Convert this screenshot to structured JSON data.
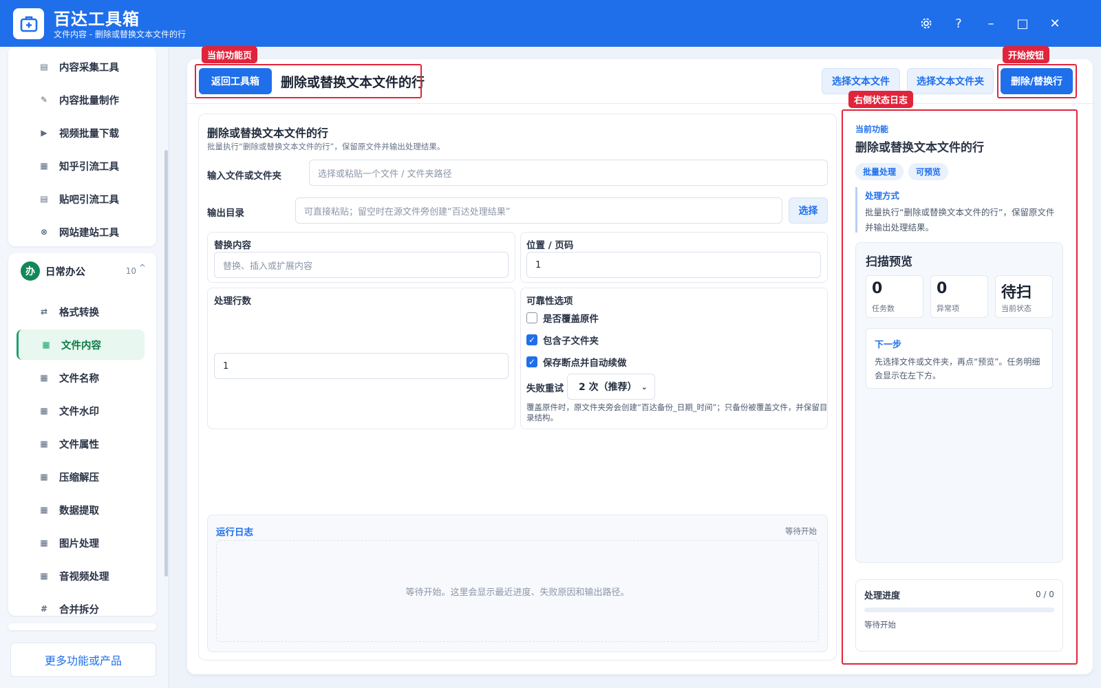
{
  "titlebar": {
    "title": "百达工具箱",
    "subtitle": "文件内容 - 删除或替换文本文件的行",
    "settings_icon": "gear-icon",
    "help_label": "?",
    "minimize_label": "–",
    "maximize_label": "□",
    "close_label": "✕"
  },
  "sidebar": {
    "top_items": [
      {
        "label": "内容采集工具",
        "icon": "▤"
      },
      {
        "label": "内容批量制作",
        "icon": "✎"
      },
      {
        "label": "视频批量下载",
        "icon": "▶"
      },
      {
        "label": "知乎引流工具",
        "icon": "▦"
      },
      {
        "label": "贴吧引流工具",
        "icon": "▤"
      },
      {
        "label": "网站建站工具",
        "icon": "⊗"
      }
    ],
    "group": {
      "badge": "办",
      "name": "日常办公",
      "count": "10",
      "caret": "^"
    },
    "group_items": [
      {
        "label": "格式转换",
        "icon": "⇄"
      },
      {
        "label": "文件内容",
        "icon": "▦"
      },
      {
        "label": "文件名称",
        "icon": "▦"
      },
      {
        "label": "文件水印",
        "icon": "▦"
      },
      {
        "label": "文件属性",
        "icon": "▦"
      },
      {
        "label": "压缩解压",
        "icon": "▦"
      },
      {
        "label": "数据提取",
        "icon": "▦"
      },
      {
        "label": "图片处理",
        "icon": "▦"
      },
      {
        "label": "音视频处理",
        "icon": "▦"
      },
      {
        "label": "合并拆分",
        "icon": "#"
      }
    ],
    "active_item": "文件内容",
    "more_label": "更多功能或产品"
  },
  "toolbar": {
    "back_label": "返回工具箱",
    "page_title": "删除或替换文本文件的行",
    "select_file_label": "选择文本文件",
    "select_folder_label": "选择文本文件夹",
    "run_label": "删除/替换行"
  },
  "annotations": {
    "current_page": "当前功能页",
    "start_button": "开始按钮",
    "status_log": "右侧状态日志"
  },
  "form": {
    "title": "删除或替换文本文件的行",
    "description": "批量执行“删除或替换文本文件的行”，保留原文件并输出处理结果。",
    "input_label": "输入文件或文件夹",
    "input_placeholder": "选择或粘贴一个文件 / 文件夹路径",
    "output_label": "输出目录",
    "output_placeholder": "可直接粘贴；留空时在源文件旁创建“百达处理结果”",
    "output_button": "选择",
    "replace_label": "替换内容",
    "replace_placeholder": "替换、插入或扩展内容",
    "position_label": "位置 / 页码",
    "position_value": "1",
    "lines_label": "处理行数",
    "lines_value": "1",
    "options_label": "可靠性选项",
    "options": [
      {
        "label": "是否覆盖原件",
        "checked": false
      },
      {
        "label": "包含子文件夹",
        "checked": true
      },
      {
        "label": "保存断点并自动续做",
        "checked": true
      }
    ],
    "retry_label": "失败重试",
    "retry_value": "2 次（推荐）",
    "note": "覆盖原件时，原文件夹旁会创建“百达备份_日期_时间”；只备份被覆盖文件，并保留目录结构。"
  },
  "log": {
    "title": "运行日志",
    "status": "等待开始",
    "placeholder": "等待开始。这里会显示最近进度、失败原因和输出路径。"
  },
  "status_panel": {
    "current_label": "当前功能",
    "current_title": "删除或替换文本文件的行",
    "tags": [
      "批量处理",
      "可预览"
    ],
    "method_label": "处理方式",
    "method_text_1": "批量执行“删除或替换文本文件的行”，保留原文件",
    "method_text_2": "并输出处理结果。",
    "scan_title": "扫描预览",
    "stats": [
      {
        "value": "0",
        "label": "任务数"
      },
      {
        "value": "0",
        "label": "异常项"
      },
      {
        "value": "待扫",
        "label": "当前状态"
      }
    ],
    "next_title": "下一步",
    "next_text_1": "先选择文件或文件夹，再点“预览”。任务明细",
    "next_text_2": "会显示在左下方。",
    "progress_title": "处理进度",
    "progress_count": "0 / 0",
    "progress_fraction": 0,
    "progress_status": "等待开始"
  },
  "colors": {
    "primary": "#1f6feb",
    "accent_green": "#1aa36a",
    "annotation_red": "#e0243b"
  }
}
